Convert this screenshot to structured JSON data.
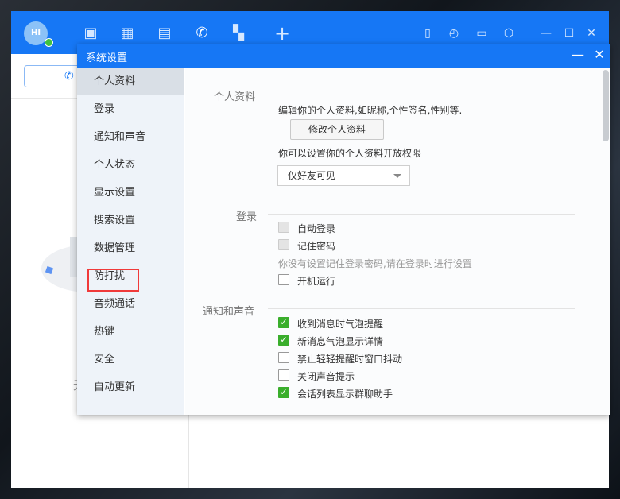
{
  "main": {
    "avatar_text": "HI",
    "nav_icons": [
      "chat-icon",
      "calendar-icon",
      "contacts-icon",
      "phone-icon",
      "apps-icon",
      "add-icon"
    ],
    "tool_icons": [
      "bookmark-icon",
      "history-icon",
      "folder-icon",
      "settings-icon"
    ],
    "empty_text": "无"
  },
  "dialog": {
    "title": "系统设置",
    "sidebar": [
      "个人资料",
      "登录",
      "通知和声音",
      "个人状态",
      "显示设置",
      "搜索设置",
      "数据管理",
      "防打扰",
      "音频通话",
      "热键",
      "安全",
      "自动更新"
    ],
    "active_index": 0,
    "highlighted_item": "防打扰",
    "highlight_color": "#f03a3a",
    "profile": {
      "section": "个人资料",
      "desc": "编辑你的个人资料,如昵称,个性签名,性别等.",
      "edit_button": "修改个人资料",
      "permission_label": "你可以设置你的个人资料开放权限",
      "permission_value": "仅好友可见"
    },
    "login": {
      "section": "登录",
      "auto_login": {
        "label": "自动登录",
        "checked": false,
        "disabled": true
      },
      "remember_pwd": {
        "label": "记住密码",
        "checked": false,
        "disabled": true
      },
      "hint": "你没有设置记住登录密码,请在登录时进行设置",
      "startup": {
        "label": "开机运行",
        "checked": false
      }
    },
    "notify": {
      "section": "通知和声音",
      "options": [
        {
          "label": "收到消息时气泡提醒",
          "checked": true
        },
        {
          "label": "新消息气泡显示详情",
          "checked": true
        },
        {
          "label": "禁止轻轻提醒时窗口抖动",
          "checked": false
        },
        {
          "label": "关闭声音提示",
          "checked": false
        },
        {
          "label": "会话列表显示群聊助手",
          "checked": true
        }
      ]
    }
  },
  "colors": {
    "brand": "#1677f5",
    "check": "#3aae2c"
  }
}
